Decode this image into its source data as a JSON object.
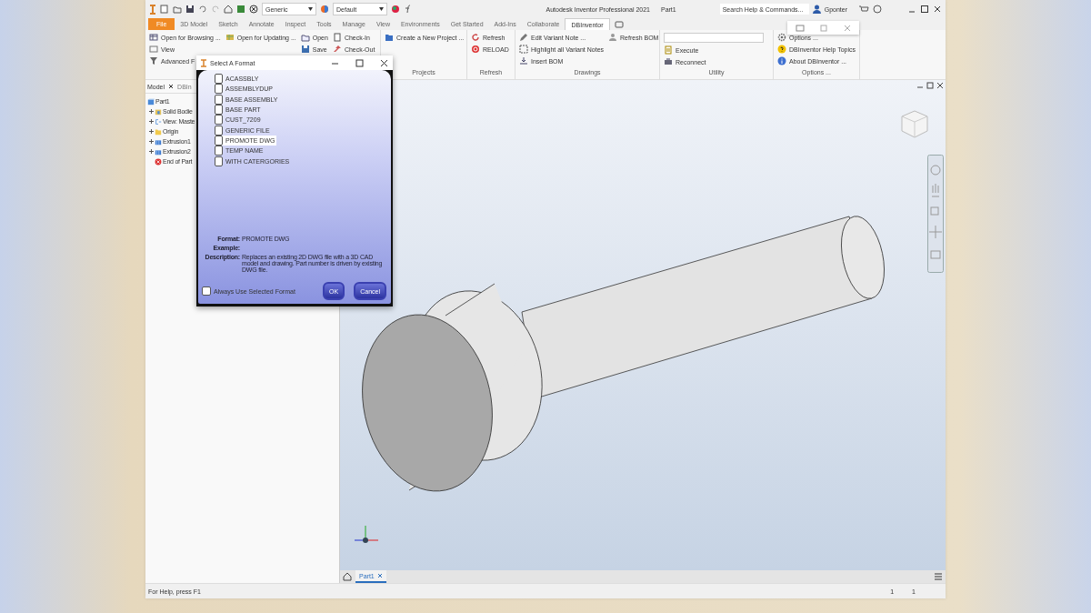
{
  "title_bar": {
    "style_dropdown": "Generic",
    "appearance_dropdown": "Default",
    "title": "Autodesk Inventor Professional 2021",
    "document": "Part1",
    "search": {
      "placeholder": "Search Help & Commands..."
    },
    "user": "Gponter"
  },
  "ribbon_tabs": [
    {
      "label": "File",
      "kind": "file",
      "selected": false
    },
    {
      "label": "3D Model",
      "kind": "tab",
      "selected": false
    },
    {
      "label": "Sketch",
      "kind": "tab",
      "selected": false
    },
    {
      "label": "Annotate",
      "kind": "tab",
      "selected": false
    },
    {
      "label": "Inspect",
      "kind": "tab",
      "selected": false
    },
    {
      "label": "Tools",
      "kind": "tab",
      "selected": false
    },
    {
      "label": "Manage",
      "kind": "tab",
      "selected": false
    },
    {
      "label": "View",
      "kind": "tab",
      "selected": false
    },
    {
      "label": "Environments",
      "kind": "tab",
      "selected": false
    },
    {
      "label": "Get Started",
      "kind": "tab",
      "selected": false
    },
    {
      "label": "Add-Ins",
      "kind": "tab",
      "selected": false
    },
    {
      "label": "Collaborate",
      "kind": "tab",
      "selected": false
    },
    {
      "label": "DBInventor",
      "kind": "tab",
      "selected": true
    }
  ],
  "ribbon_groups": [
    {
      "columns": [
        [
          {
            "kind": "button",
            "label": "Open for Browsing ..."
          },
          {
            "kind": "button",
            "label": "View"
          },
          {
            "kind": "button",
            "label": "Advanced F"
          }
        ],
        [
          {
            "kind": "button",
            "label": "Open for Updating ..."
          }
        ],
        [
          {
            "kind": "button",
            "label": "Open"
          },
          {
            "kind": "button",
            "label": "Save"
          }
        ],
        [
          {
            "kind": "button",
            "label": "Check-In"
          },
          {
            "kind": "button",
            "label": "Check-Out"
          }
        ]
      ]
    },
    {
      "label": "Projects",
      "columns": [
        [
          {
            "kind": "button",
            "label": "Create a New Project ..."
          }
        ]
      ]
    },
    {
      "label": "Refresh",
      "columns": [
        [
          {
            "kind": "button",
            "label": "Refresh"
          },
          {
            "kind": "button",
            "label": "RELOAD"
          }
        ]
      ]
    },
    {
      "label": "Drawings",
      "columns": [
        [
          {
            "kind": "button",
            "label": "Edit Variant Note ..."
          },
          {
            "kind": "button",
            "label": "Highlight all Variant Notes"
          },
          {
            "kind": "button",
            "label": "Insert BOM"
          }
        ],
        [
          {
            "kind": "button",
            "label": "Refresh BOM"
          }
        ]
      ]
    },
    {
      "label": "Utility",
      "columns": [
        [
          {
            "kind": "dropdown"
          },
          {
            "kind": "button",
            "label": "Execute"
          },
          {
            "kind": "button",
            "label": "Reconnect"
          }
        ]
      ]
    },
    {
      "label": "Options ...",
      "columns": [
        [
          {
            "kind": "button",
            "label": "Options ..."
          },
          {
            "kind": "button",
            "label": "DBInventor Help Topics"
          },
          {
            "kind": "button",
            "label": "About DBInventor ..."
          }
        ]
      ]
    }
  ],
  "browser": {
    "tabs": [
      {
        "label": "Model",
        "selected": true
      },
      {
        "label": "DBIn",
        "selected": false
      }
    ],
    "tree": [
      {
        "label": "Part1",
        "children": [
          {
            "label": "Solid Bodie",
            "expanded": false
          },
          {
            "label": "View: Maste",
            "expanded": false
          },
          {
            "label": "Origin",
            "expanded": false
          },
          {
            "label": "Extrusion1",
            "expanded": false
          },
          {
            "label": "Extrusion2",
            "expanded": false
          },
          {
            "label": "End of Part"
          }
        ]
      }
    ]
  },
  "document_tabs": [
    {
      "label": "Part1",
      "selected": true
    }
  ],
  "status_bar": {
    "help": "For Help, press F1",
    "fields": [
      "1",
      "1"
    ]
  },
  "dialog": {
    "title": "Select A Format",
    "formats": [
      {
        "label": "ACASSBLY",
        "checked": false,
        "selected": false
      },
      {
        "label": "ASSEMBLYDUP",
        "checked": false,
        "selected": false
      },
      {
        "label": "BASE ASSEMBLY",
        "checked": false,
        "selected": false
      },
      {
        "label": "BASE PART",
        "checked": false,
        "selected": false
      },
      {
        "label": "CUST_7209",
        "checked": false,
        "selected": false
      },
      {
        "label": "GENERIC FILE",
        "checked": false,
        "selected": false
      },
      {
        "label": "PROMOTE DWG",
        "checked": false,
        "selected": true
      },
      {
        "label": "TEMP NAME",
        "checked": false,
        "selected": false
      },
      {
        "label": "WITH CATERGORIES",
        "checked": false,
        "selected": false
      }
    ],
    "format_label": "Format:",
    "format_value": "PROMOTE DWG",
    "example_label": "Example:",
    "description_label": "Description:",
    "description": "Replaces an existing 2D DWG file with a 3D CAD model and drawing.  Part number is driven by existing DWG file.",
    "always_use": {
      "label": "Always Use Selected Format",
      "checked": false
    },
    "buttons": [
      "OK",
      "Cancel"
    ]
  }
}
